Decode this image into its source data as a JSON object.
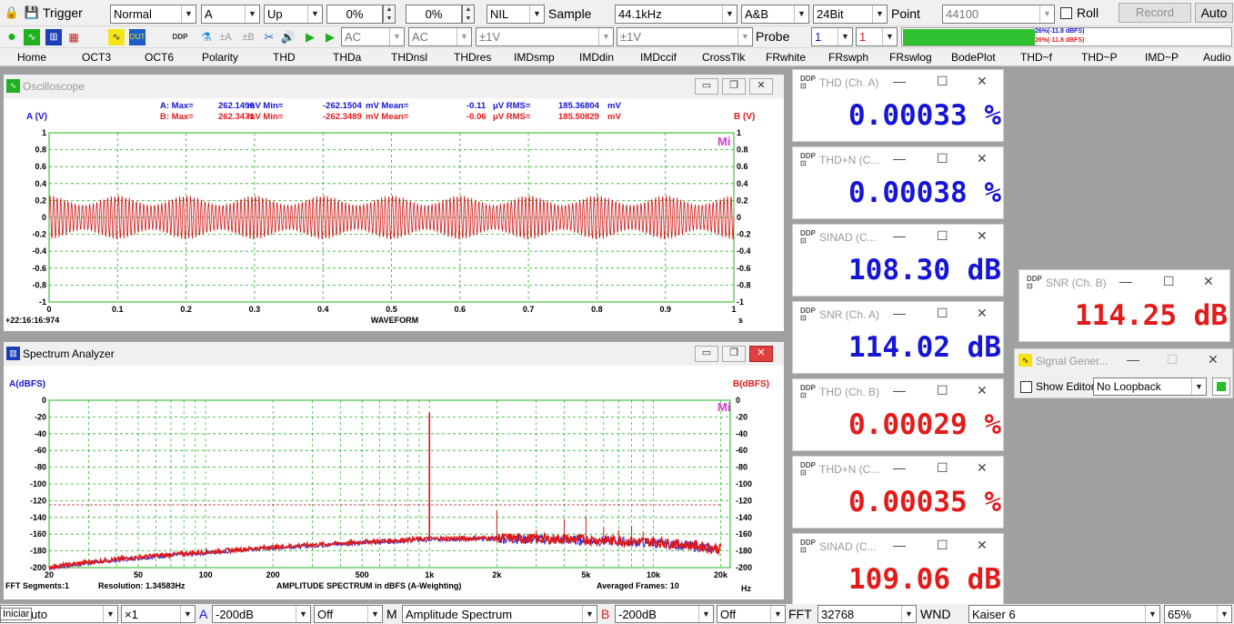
{
  "toolbar1": {
    "trigger_label": "Trigger",
    "trigger_mode": "Normal",
    "trigger_channel": "A",
    "trigger_edge": "Up",
    "trigger_level1": "0%",
    "trigger_level2": "0%",
    "nil": "NIL",
    "sample_label": "Sample",
    "sample_rate": "44.1kHz",
    "channels": "A&B",
    "bits": "24Bit",
    "point_label": "Point",
    "points": "44100",
    "roll_label": "Roll",
    "record_label": "Record",
    "auto_label": "Auto"
  },
  "toolbar2": {
    "coupling_a": "AC",
    "coupling_b": "AC",
    "range_a": "±1V",
    "range_b": "±1V",
    "probe_label": "Probe",
    "probe_a": "1",
    "probe_b": "1",
    "level_a_text": "26%(-11.8 dBFS)",
    "level_b_text": "26%(-11.8 dBFS)",
    "level_a_fraction": 0.26,
    "level_b_fraction": 0.26
  },
  "tabs": [
    "Home",
    "OCT3",
    "OCT6",
    "Polarity",
    "THD",
    "THDa",
    "THDnsl",
    "THDres",
    "IMDsmp",
    "IMDdin",
    "IMDccif",
    "CrossTlk",
    "FRwhite",
    "FRswph",
    "FRswlog",
    "BodePlot",
    "THD~f",
    "THD~P",
    "IMD~P",
    "Audio"
  ],
  "oscilloscope": {
    "title": "Oscilloscope",
    "stats_a": {
      "label": "A:",
      "max_label": "Max=",
      "max": "262.1496",
      "min_label": "mV  Min=",
      "min": "-262.1504",
      "mean_label": "mV  Mean=",
      "mean": "-0.11",
      "rms_label": "μV  RMS=",
      "rms": "185.36804",
      "unit": "mV"
    },
    "stats_b": {
      "label": "B:",
      "max_label": "Max=",
      "max": "262.3471",
      "min_label": "mV  Min=",
      "min": "-262.3489",
      "mean_label": "mV  Mean=",
      "mean": "-0.06",
      "rms_label": "μV  RMS=",
      "rms": "185.50829",
      "unit": "mV"
    },
    "timestamp": "+22:16:16:974",
    "mi_label": "Mi"
  },
  "spectrum": {
    "title": "Spectrum Analyzer",
    "fft_segments": "FFT Segments:1",
    "resolution": "Resolution: 1.34583Hz",
    "averaged_frames": "Averaged Frames: 10",
    "mi_label": "Mi"
  },
  "chart_data": [
    {
      "type": "line",
      "title": "",
      "xlabel": "WAVEFORM",
      "ylabel": "A (V)",
      "ylabel_right": "B (V)",
      "x_unit": "s",
      "xlim": [
        0,
        1
      ],
      "ylim": [
        -1,
        1
      ],
      "x_ticks": [
        "0",
        "0.1",
        "0.2",
        "0.3",
        "0.4",
        "0.5",
        "0.6",
        "0.7",
        "0.8",
        "0.9",
        "1"
      ],
      "y_ticks": [
        "1",
        "0.8",
        "0.6",
        "0.4",
        "0.2",
        "0",
        "-0.2",
        "-0.4",
        "-0.6",
        "-0.8",
        "-1"
      ],
      "grid": true,
      "series": [
        {
          "envelope_peak": 0.262,
          "envelope_min": 0.15,
          "beat_periods": 10,
          "color": "#d01818"
        }
      ]
    },
    {
      "type": "line",
      "title": "",
      "xlabel": "AMPLITUDE SPECTRUM in dBFS (A-Weighting)",
      "ylabel": "A(dBFS)",
      "ylabel_right": "B(dBFS)",
      "x_unit": "Hz",
      "x_scale": "log",
      "xlim": [
        20,
        22050
      ],
      "ylim": [
        -200,
        0
      ],
      "x_ticks": [
        "20",
        "50",
        "100",
        "200",
        "500",
        "1k",
        "2k",
        "5k",
        "10k",
        "20k"
      ],
      "y_ticks": [
        "0",
        "-20",
        "-40",
        "-60",
        "-80",
        "-100",
        "-120",
        "-140",
        "-160",
        "-180",
        "-200"
      ],
      "reference_line_db": -125,
      "grid": true,
      "peaks": [
        {
          "x": 1000,
          "y": -15
        },
        {
          "x": 2000,
          "y": -132
        },
        {
          "x": 3000,
          "y": -155
        },
        {
          "x": 4000,
          "y": -142
        },
        {
          "x": 5000,
          "y": -139
        },
        {
          "x": 6000,
          "y": -152
        },
        {
          "x": 7000,
          "y": -155
        },
        {
          "x": 8000,
          "y": -150
        },
        {
          "x": 9000,
          "y": -157
        },
        {
          "x": 10000,
          "y": -162
        }
      ],
      "noise_floor": [
        {
          "x": 20,
          "y": -200
        },
        {
          "x": 30,
          "y": -194
        },
        {
          "x": 50,
          "y": -188
        },
        {
          "x": 100,
          "y": -182
        },
        {
          "x": 200,
          "y": -176
        },
        {
          "x": 500,
          "y": -170
        },
        {
          "x": 1000,
          "y": -166
        },
        {
          "x": 2000,
          "y": -165
        },
        {
          "x": 5000,
          "y": -167
        },
        {
          "x": 10000,
          "y": -170
        },
        {
          "x": 15000,
          "y": -174
        },
        {
          "x": 20000,
          "y": -178
        }
      ]
    }
  ],
  "meters": [
    {
      "title": "THD (Ch. A)",
      "value": "0.00033  %",
      "color": "#1515d6"
    },
    {
      "title": "THD+N (C...",
      "value": "0.00038  %",
      "color": "#1515d6"
    },
    {
      "title": "SINAD (C...",
      "value": "108.30  dB",
      "color": "#1515d6"
    },
    {
      "title": "SNR (Ch. A)",
      "value": "114.02  dB",
      "color": "#1515d6"
    },
    {
      "title": "THD (Ch. B)",
      "value": "0.00029  %",
      "color": "#e21b1b"
    },
    {
      "title": "THD+N (C...",
      "value": "0.00035  %",
      "color": "#e21b1b"
    },
    {
      "title": "SINAD (C...",
      "value": "109.06  dB",
      "color": "#e21b1b"
    }
  ],
  "snr_b": {
    "title": "SNR (Ch. B)",
    "value": "114.25  dB",
    "color": "#e21b1b"
  },
  "signal_generator": {
    "title": "Signal Gener...",
    "show_editor_label": "Show Editor",
    "loopback": "No Loopback"
  },
  "statusbar": {
    "start_tooltip": "Iniciar",
    "mode": "uto",
    "zoom": "×1",
    "ch_a_label": "A",
    "ch_a_level": "-200dB",
    "ch_a_off": "Off",
    "m_label": "M",
    "analysis": "Amplitude Spectrum",
    "ch_b_label": "B",
    "ch_b_level": "-200dB",
    "ch_b_off": "Off",
    "fft_label": "FFT",
    "fft_size": "32768",
    "wnd_label": "WND",
    "window": "Kaiser 6",
    "overlap": "65%"
  }
}
